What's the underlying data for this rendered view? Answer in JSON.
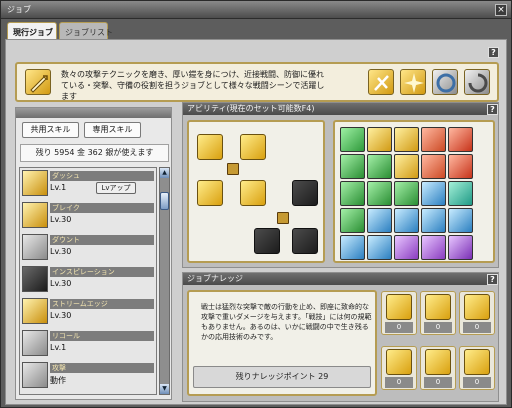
{
  "window": {
    "title": "ジョブ",
    "close_symbol": "×"
  },
  "tabs": [
    {
      "label": "現行ジョブ"
    },
    {
      "label": "ジョブリスト"
    }
  ],
  "help_symbol": "?",
  "job": {
    "description": "数々の攻撃テクニックを磨き、厚い鎧を身につけ、近接戦闘、防御に優れている・突撃、守備の役割を担うジョブとして様々な戦闘シーンで活躍します",
    "icons": [
      "sword-strike-icon",
      "yellow-burst-icon",
      "gold-fist-icon",
      "grey-shield-icon",
      "grey-whirl-icon"
    ]
  },
  "skills": {
    "tabs": [
      {
        "label": "共用スキル"
      },
      {
        "label": "専用スキル"
      }
    ],
    "points_text": "残り 5954 金 362 銀が使えます",
    "levelup_label": "Lvアップ",
    "items": [
      {
        "name": "ダッシュ",
        "level": "Lv.1",
        "icon": "dash-icon"
      },
      {
        "name": "ブレイク",
        "level": "Lv.30",
        "icon": "break-icon"
      },
      {
        "name": "ダウント",
        "level": "Lv.30",
        "icon": "taunt-icon"
      },
      {
        "name": "インスピレーション",
        "level": "Lv.30",
        "icon": "inspiration-icon"
      },
      {
        "name": "ストリームエッジ",
        "level": "Lv.30",
        "icon": "stream-edge-icon"
      },
      {
        "name": "リコール",
        "level": "Lv.1",
        "icon": "recall-icon"
      },
      {
        "name": "攻撃",
        "level": "動作",
        "icon": "attack-icon"
      }
    ]
  },
  "ability": {
    "title": "アビリティ(現在のセット可能数F4)"
  },
  "knowledge": {
    "title": "ジョブナレッジ",
    "description": "戦士は猛烈な突撃で敵の行動を止め、即座に致命的な攻撃で重いダメージを与えます。「戦技」には何の規範もありません。あるのは、いかに戦闘の中で生き残るかの応用技術のみです。",
    "points_text": "残りナレッジポイント 29",
    "items": [
      {
        "icon": "fury-face-icon",
        "value": "0"
      },
      {
        "icon": "cross-blades-icon",
        "value": "0"
      },
      {
        "icon": "lion-crest-icon",
        "value": "0"
      },
      {
        "icon": "warrior-face-icon",
        "value": "0"
      },
      {
        "icon": "crossed-swords-icon",
        "value": "0"
      },
      {
        "icon": "flame-sword-icon",
        "value": "0"
      }
    ]
  }
}
